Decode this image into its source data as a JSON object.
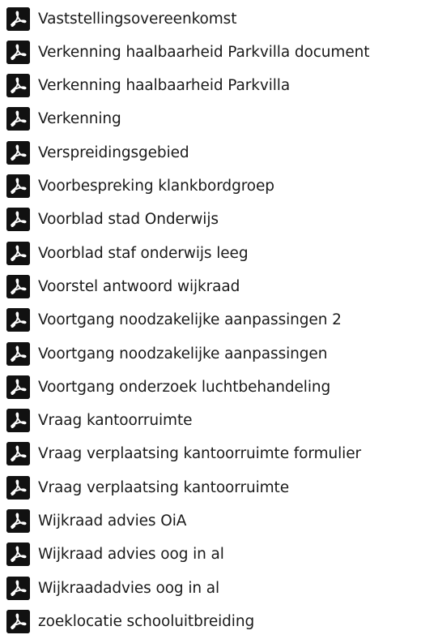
{
  "files": [
    {
      "name": "Vaststellingsovereenkomst",
      "icon": "pdf-icon"
    },
    {
      "name": "Verkenning haalbaarheid Parkvilla document",
      "icon": "pdf-icon"
    },
    {
      "name": "Verkenning haalbaarheid Parkvilla",
      "icon": "pdf-icon"
    },
    {
      "name": "Verkenning",
      "icon": "pdf-icon"
    },
    {
      "name": "Verspreidingsgebied",
      "icon": "pdf-icon"
    },
    {
      "name": "Voorbespreking klankbordgroep",
      "icon": "pdf-icon"
    },
    {
      "name": "Voorblad stad Onderwijs",
      "icon": "pdf-icon"
    },
    {
      "name": "Voorblad staf onderwijs leeg",
      "icon": "pdf-icon"
    },
    {
      "name": "Voorstel antwoord wijkraad",
      "icon": "pdf-icon"
    },
    {
      "name": "Voortgang noodzakelijke aanpassingen 2",
      "icon": "pdf-icon"
    },
    {
      "name": "Voortgang noodzakelijke aanpassingen",
      "icon": "pdf-icon"
    },
    {
      "name": "Voortgang onderzoek luchtbehandeling",
      "icon": "pdf-icon"
    },
    {
      "name": "Vraag kantoorruimte",
      "icon": "pdf-icon"
    },
    {
      "name": "Vraag verplaatsing kantoorruimte formulier",
      "icon": "pdf-icon"
    },
    {
      "name": "Vraag verplaatsing kantoorruimte",
      "icon": "pdf-icon"
    },
    {
      "name": "Wijkraad advies OiA",
      "icon": "pdf-icon"
    },
    {
      "name": "Wijkraad advies oog in al",
      "icon": "pdf-icon"
    },
    {
      "name": "Wijkraadadvies oog in al",
      "icon": "pdf-icon"
    },
    {
      "name": "zoeklocatie schooluitbreiding",
      "icon": "pdf-icon"
    }
  ]
}
